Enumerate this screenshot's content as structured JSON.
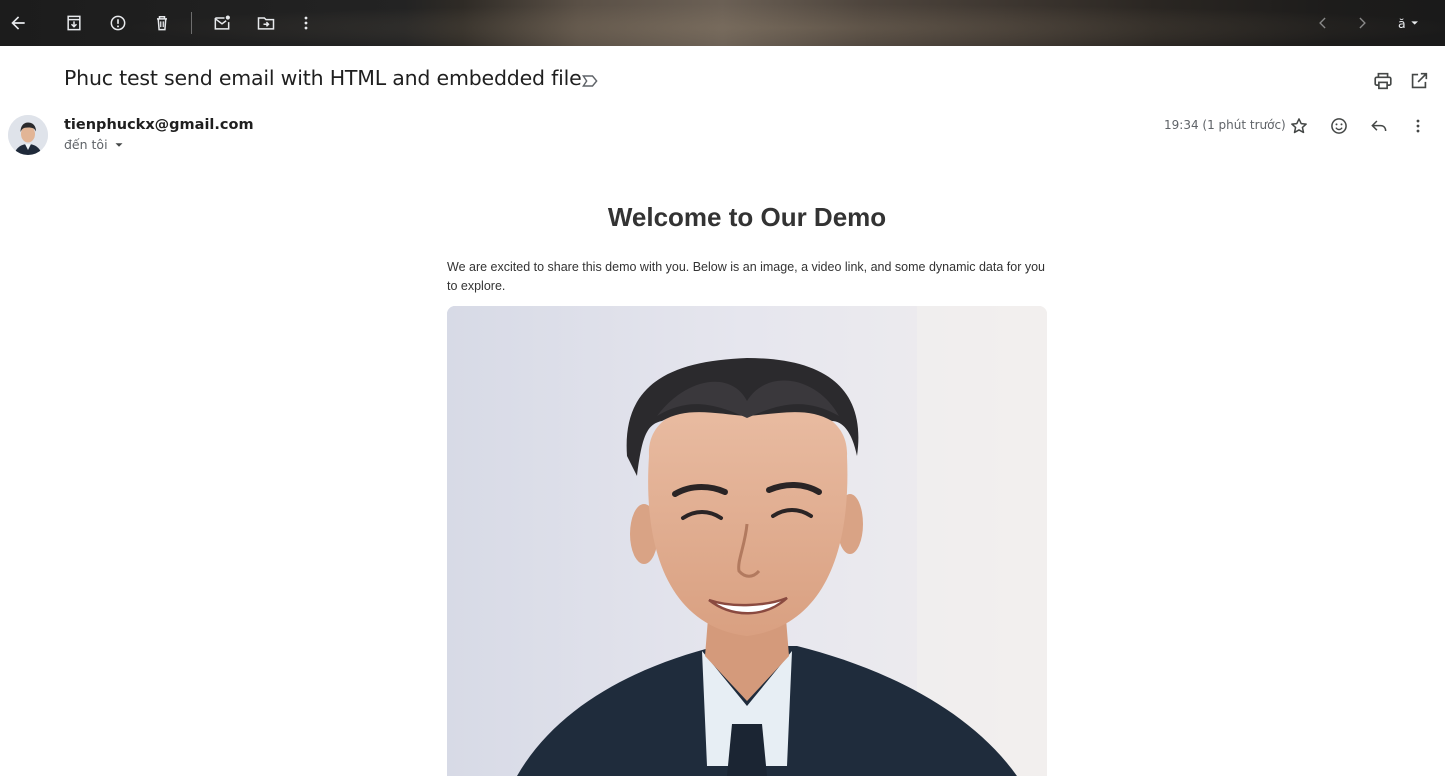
{
  "toolbar": {
    "buttons": [
      {
        "name": "back-arrow-icon"
      },
      {
        "name": "archive-icon"
      },
      {
        "name": "report-spam-icon"
      },
      {
        "name": "delete-icon"
      },
      {
        "name": "mark-unread-icon"
      },
      {
        "name": "move-to-icon"
      },
      {
        "name": "more-vert-icon"
      }
    ],
    "right": [
      {
        "name": "newer-chevron-icon"
      },
      {
        "name": "older-chevron-icon"
      },
      {
        "name": "input-tools-icon"
      }
    ]
  },
  "subject": {
    "text": "Phuc test send email with HTML and embedded file",
    "label_icon": "label-important-icon"
  },
  "header_actions": [
    "print-icon",
    "open-new-window-icon"
  ],
  "message": {
    "sender": "tienphuckx@gmail.com",
    "recipient": "đến tôi",
    "time": "19:34 (1 phút trước)",
    "actions": [
      "star-icon",
      "emoji-reaction-icon",
      "reply-icon",
      "more-vert-icon"
    ]
  },
  "email": {
    "title": "Welcome to Our Demo",
    "intro": "We are excited to share this demo with you. Below is an image, a video link, and some dynamic data for you to explore."
  },
  "colors": {
    "toolbar_bg": "#1c1c1c",
    "toolbar_icon": "#e8eaed",
    "text_primary": "#1f1f1f",
    "text_secondary": "#5f6368",
    "email_text": "#333333"
  }
}
